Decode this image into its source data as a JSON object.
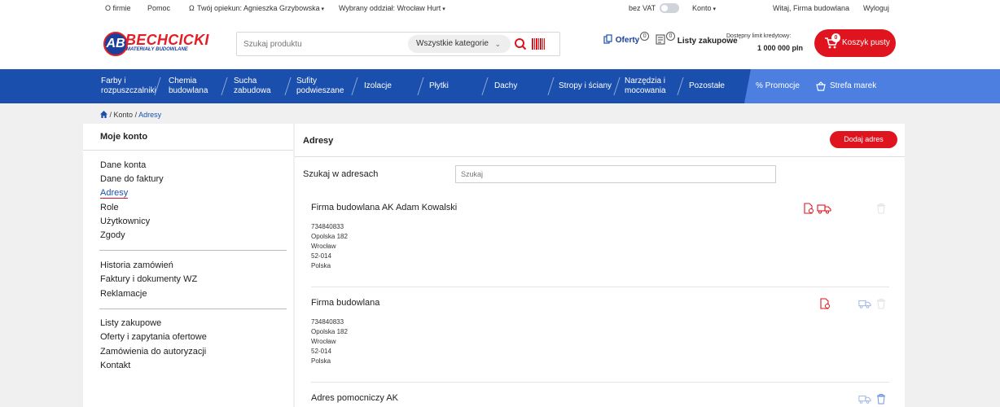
{
  "topbar": {
    "about": "O firmie",
    "help": "Pomoc",
    "advisor": "Twój opiekun: Agnieszka Grzybowska",
    "branch": "Wybrany oddział: Wrocław Hurt",
    "vat": "bez VAT",
    "account": "Konto",
    "welcome": "Witaj, Firma budowlana",
    "logout": "Wyloguj"
  },
  "header": {
    "logo_letters": "AB",
    "logo_name": "BECHCICKI",
    "logo_sub": "MATERIAŁY BUDOWLANE",
    "search_placeholder": "Szukaj produktu",
    "category": "Wszystkie kategorie",
    "offers_label": "Oferty",
    "offers_count": "0",
    "lists_label": "Listy zakupowe",
    "lists_count": "0",
    "limit_label": "Dostępny limit kredytowy:",
    "limit_value": "1 000 000 pln",
    "cart_count": "0",
    "cart_label": "Koszyk pusty"
  },
  "nav": {
    "items": [
      "Farby i rozpuszczalniki",
      "Chemia budowlana",
      "Sucha zabudowa",
      "Sufity podwieszane",
      "Izolacje",
      "Płytki",
      "Dachy",
      "Stropy i ściany",
      "Narzędzia i mocowania",
      "Pozostałe"
    ],
    "promo": "% Promocje",
    "brands": "Strefa marek"
  },
  "breadcrumb": {
    "account": "Konto",
    "current": "Adresy",
    "sep": "/"
  },
  "sidebar": {
    "title": "Moje konto",
    "group1": [
      "Dane konta",
      "Dane do faktury",
      "Adresy",
      "Role",
      "Użytkownicy",
      "Zgody"
    ],
    "group2": [
      "Historia zamówień",
      "Faktury i dokumenty WZ",
      "Reklamacje"
    ],
    "group3": [
      "Listy zakupowe",
      "Oferty i zapytania ofertowe",
      "Zamówienia do autoryzacji",
      "Kontakt"
    ]
  },
  "main": {
    "title": "Adresy",
    "add_button": "Dodaj adres",
    "search_label": "Szukaj w adresach",
    "search_placeholder": "Szukaj",
    "addresses": [
      {
        "name": "Firma budowlana AK Adam Kowalski",
        "lines": [
          "734840833",
          "Opolska 182",
          "Wrocław",
          "52-014",
          "Polska"
        ]
      },
      {
        "name": "Firma budowlana",
        "lines": [
          "734840833",
          "Opolska 182",
          "Wrocław",
          "52-014",
          "Polska"
        ]
      },
      {
        "name": "Adres pomocniczy AK",
        "lines": []
      }
    ]
  },
  "colors": {
    "brand_red": "#e0141e",
    "brand_blue": "#1b4fad",
    "promo_blue": "#4c7fe0"
  }
}
